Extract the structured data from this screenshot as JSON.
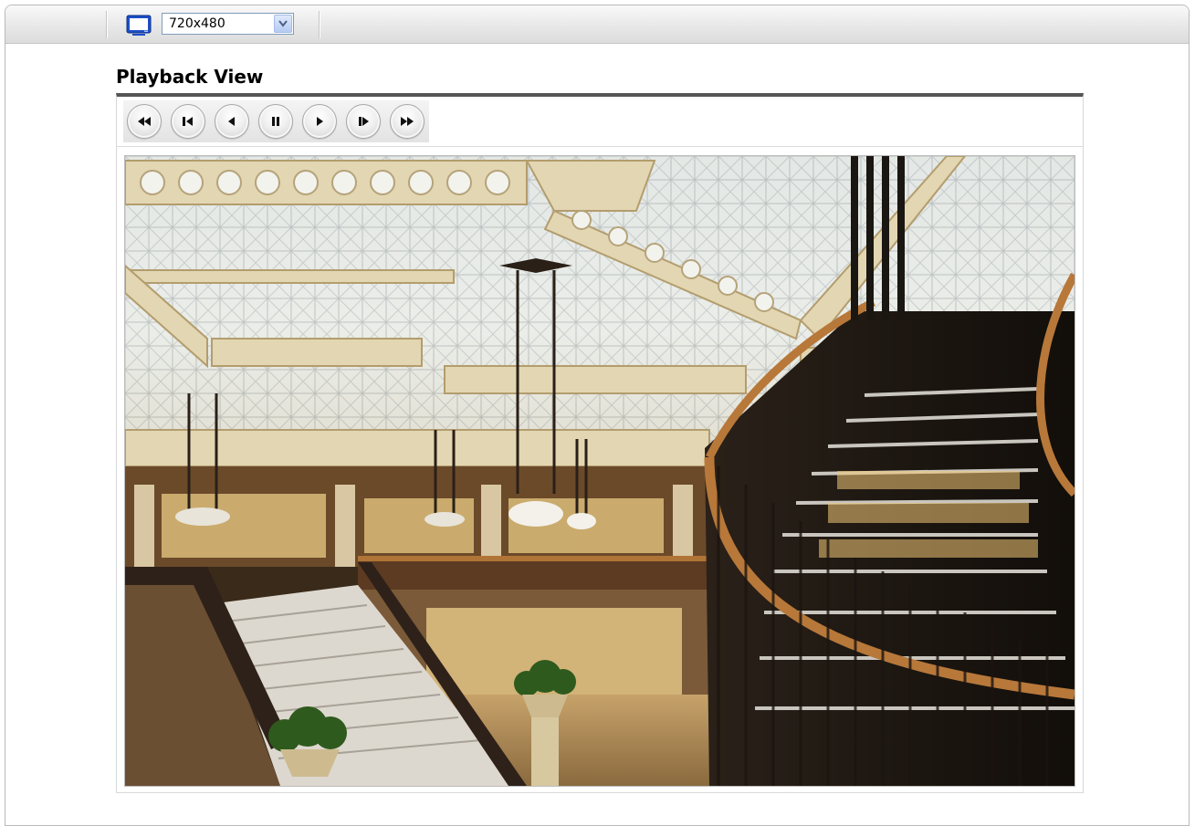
{
  "toolbar": {
    "monitor_icon": "monitor-icon",
    "resolution": {
      "selected": "720x480"
    }
  },
  "page": {
    "title": "Playback View"
  },
  "playback_controls": [
    {
      "name": "fast-rewind",
      "icon": "fast-rewind-icon"
    },
    {
      "name": "step-back",
      "icon": "step-back-icon"
    },
    {
      "name": "play-reverse",
      "icon": "play-reverse-icon"
    },
    {
      "name": "pause",
      "icon": "pause-icon"
    },
    {
      "name": "play",
      "icon": "play-icon"
    },
    {
      "name": "step-forward",
      "icon": "step-forward-icon"
    },
    {
      "name": "fast-forward",
      "icon": "fast-forward-icon"
    }
  ],
  "video": {
    "description_icon": "video-frame"
  },
  "colors": {
    "accent": "#555555",
    "select_border": "#7f9db9",
    "monitor_blue": "#1d4fc7"
  }
}
